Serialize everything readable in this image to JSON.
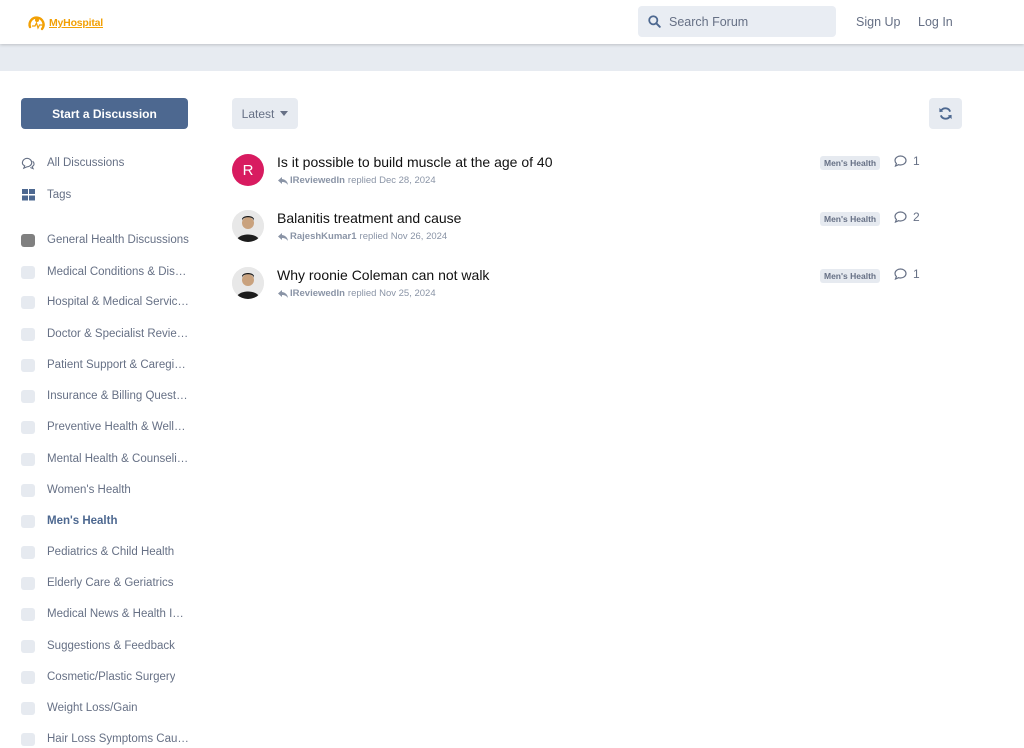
{
  "header": {
    "logo_text": "MyHospital",
    "search_placeholder": "Search Forum",
    "sign_up": "Sign Up",
    "log_in": "Log In",
    "brand_color": "#f2a005"
  },
  "sidebar": {
    "start_label": "Start a Discussion",
    "nav": [
      {
        "label": "All Discussions",
        "icon": "comments-icon"
      },
      {
        "label": "Tags",
        "icon": "tags-grid-icon"
      }
    ],
    "tags": [
      {
        "label": "General Health Discussions",
        "color": "#808080"
      },
      {
        "label": "Medical Conditions & Diseases"
      },
      {
        "label": "Hospital & Medical Services"
      },
      {
        "label": "Doctor & Specialist Reviews"
      },
      {
        "label": "Patient Support & Caregiving"
      },
      {
        "label": "Insurance & Billing Questions"
      },
      {
        "label": "Preventive Health & Wellness"
      },
      {
        "label": "Mental Health & Counseling"
      },
      {
        "label": "Women's Health"
      },
      {
        "label": "Men's Health",
        "active": true
      },
      {
        "label": "Pediatrics & Child Health"
      },
      {
        "label": "Elderly Care & Geriatrics"
      },
      {
        "label": "Medical News & Health Innovations"
      },
      {
        "label": "Suggestions & Feedback"
      },
      {
        "label": "Cosmetic/Plastic Surgery"
      },
      {
        "label": "Weight Loss/Gain"
      },
      {
        "label": "Hair Loss Symptoms Causes"
      }
    ]
  },
  "toolbar": {
    "sort_label": "Latest"
  },
  "discussions": [
    {
      "title": "Is it possible to build muscle at the age of 40",
      "user": "IReviewedIn",
      "action": "replied",
      "date": "Dec 28, 2024",
      "tag": "Men's Health",
      "replies": "1",
      "avatar_letter": "R"
    },
    {
      "title": "Balanitis treatment and cause",
      "user": "RajeshKumar1",
      "action": "replied",
      "date": "Nov 26, 2024",
      "tag": "Men's Health",
      "replies": "2"
    },
    {
      "title": "Why roonie Coleman can not walk",
      "user": "IReviewedIn",
      "action": "replied",
      "date": "Nov 25, 2024",
      "tag": "Men's Health",
      "replies": "1"
    }
  ]
}
